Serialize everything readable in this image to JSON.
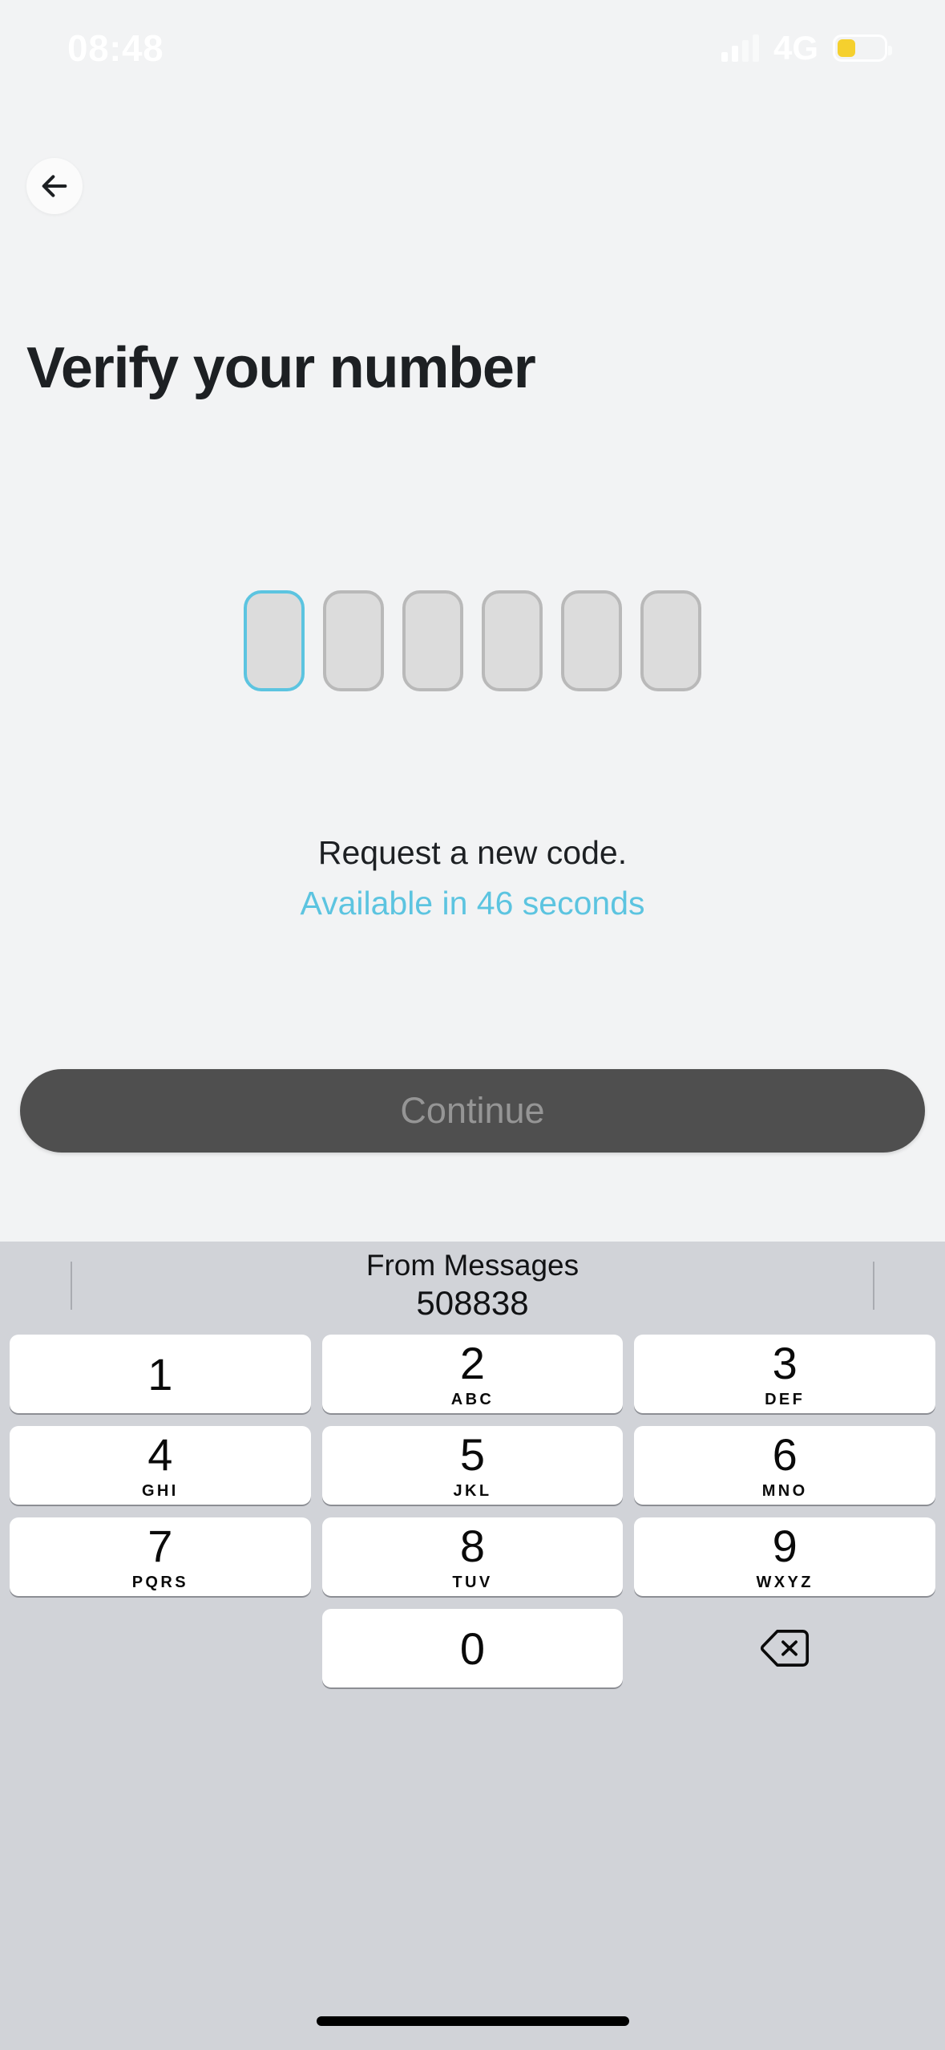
{
  "status_bar": {
    "time": "08:48",
    "network": "4G",
    "battery_level_percent": 40,
    "battery_color": "#f5d02e",
    "signal_icon": "cellular-signal-icon",
    "battery_icon": "battery-icon"
  },
  "nav": {
    "back_icon": "arrow-left-icon"
  },
  "header": {
    "title": "Verify your number"
  },
  "otp": {
    "length": 6,
    "focused_index": 0,
    "values": [
      "",
      "",
      "",
      "",
      "",
      ""
    ],
    "focus_color": "#5cc4e0",
    "box_fill": "#dcdcdc",
    "box_border": "#b9b9b9"
  },
  "resend": {
    "title": "Request a new code.",
    "timer": "Available in 46 seconds",
    "timer_color": "#5cc4e0"
  },
  "primary_action": {
    "label": "Continue",
    "enabled": false,
    "background": "#4f4f4f",
    "label_color": "#959595"
  },
  "keyboard": {
    "suggestion": {
      "source_label": "From Messages",
      "code": "508838"
    },
    "rows": [
      [
        {
          "digit": "1",
          "letters": ""
        },
        {
          "digit": "2",
          "letters": "ABC"
        },
        {
          "digit": "3",
          "letters": "DEF"
        }
      ],
      [
        {
          "digit": "4",
          "letters": "GHI"
        },
        {
          "digit": "5",
          "letters": "JKL"
        },
        {
          "digit": "6",
          "letters": "MNO"
        }
      ],
      [
        {
          "digit": "7",
          "letters": "PQRS"
        },
        {
          "digit": "8",
          "letters": "TUV"
        },
        {
          "digit": "9",
          "letters": "WXYZ"
        }
      ]
    ],
    "zero_key": {
      "digit": "0",
      "letters": ""
    },
    "delete_icon": "backspace-delete-icon",
    "background": "#d1d3d8"
  },
  "home_indicator": "home-indicator"
}
